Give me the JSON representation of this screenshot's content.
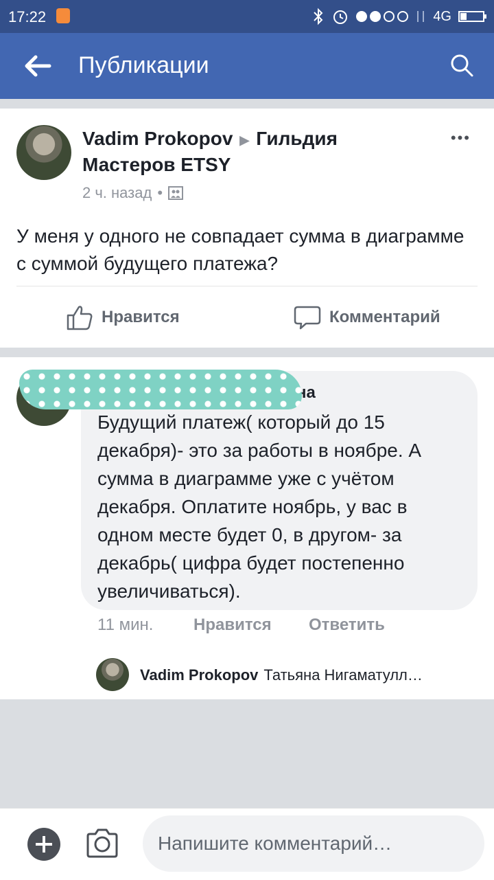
{
  "status_bar": {
    "time": "17:22",
    "network": "4G"
  },
  "app_bar": {
    "title": "Публикации"
  },
  "post": {
    "author": "Vadim Prokopov",
    "group": "Гильдия Мастеров ETSY",
    "time": "2 ч. назад",
    "text": "У меня у одного не совпадает сумма в диаграмме с суммой будущего платежа?",
    "like_label": "Нравится",
    "comment_label": "Комментарий"
  },
  "comment": {
    "author_visible_fragment": "на",
    "text": "Будущий платеж( который до 15 декабря)- это за работы в ноябре. А сумма в диаграмме уже с учётом декабря. Оплатите ноябрь, у вас в одном месте будет 0, в другом- за декабрь( цифра будет постепенно увеличиваться).",
    "time": "11 мин.",
    "like_label": "Нравится",
    "reply_label": "Ответить"
  },
  "reply": {
    "author": "Vadim Prokopov",
    "text": "Татьяна Нигаматулл…"
  },
  "input_bar": {
    "placeholder": "Напишите комментарий…"
  },
  "icons": {
    "back": "arrow-left-icon",
    "search": "search-icon",
    "more": "more-horizontal-icon",
    "privacy": "group-icon",
    "like": "thumbs-up-icon",
    "comment": "speech-bubble-icon",
    "plus": "plus-circle-icon",
    "camera": "camera-icon"
  },
  "colors": {
    "app_bar": "#4267b2",
    "status_bar": "#334f8a",
    "bubble": "#f1f2f4"
  }
}
